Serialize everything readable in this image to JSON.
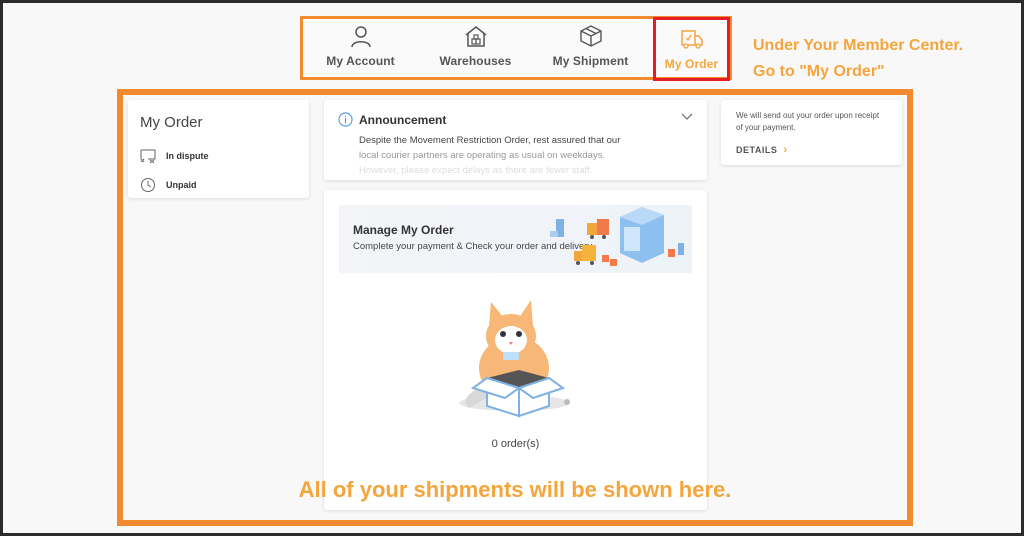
{
  "topnav": {
    "items": [
      {
        "label": "My Account",
        "icon": "user-icon"
      },
      {
        "label": "Warehouses",
        "icon": "warehouse-icon"
      },
      {
        "label": "My Shipment",
        "icon": "package-icon"
      },
      {
        "label": "My Order",
        "icon": "delivery-truck-icon",
        "active": true
      }
    ]
  },
  "callout": {
    "line1": "Under Your Member Center.",
    "line2": "Go to \"My Order\""
  },
  "sidebar": {
    "title": "My Order",
    "items": [
      {
        "label": "In dispute",
        "icon": "dispute-icon"
      },
      {
        "label": "Unpaid",
        "icon": "clock-icon"
      }
    ]
  },
  "announcement": {
    "title": "Announcement",
    "line1": "Despite the Movement Restriction Order, rest assured that our",
    "line2": "local courier partners are operating as usual on weekdays.",
    "line3": "However, please expect delays as there are fewer staff."
  },
  "info_card": {
    "text": "We will send out your order upon receipt of your payment.",
    "details_label": "DETAILS"
  },
  "manage": {
    "title": "Manage My Order",
    "subtitle": "Complete your payment & Check your order and delivery."
  },
  "orders": {
    "count_label": "0 order(s)"
  },
  "caption": "All of your shipments will be shown here.",
  "colors": {
    "accent_orange": "#f28a30",
    "highlight_red": "#e51e25",
    "text_orange": "#f4a53c"
  }
}
